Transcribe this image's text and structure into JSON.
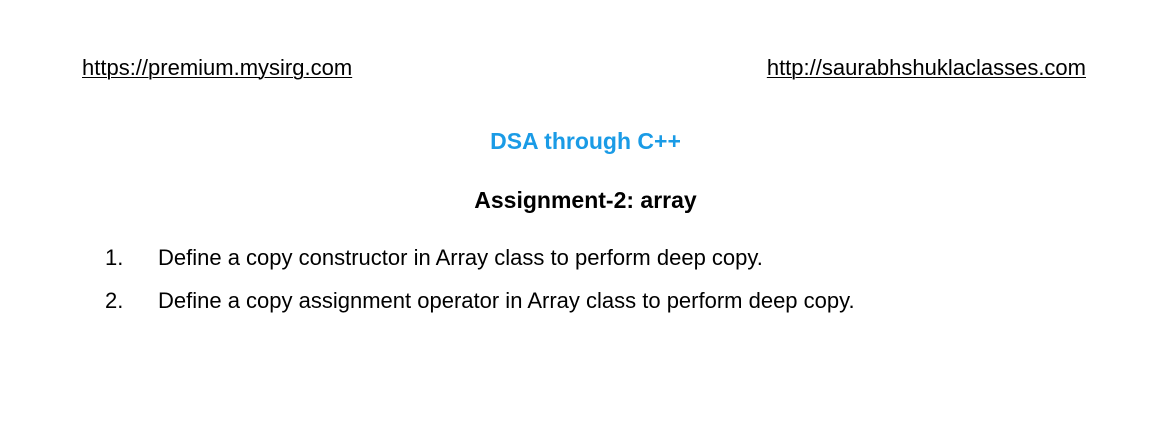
{
  "header": {
    "left_link": "https://premium.mysirg.com",
    "right_link": "http://saurabhshuklaclasses.com"
  },
  "document": {
    "course_title": "DSA through C++",
    "assignment_title": "Assignment-2: array",
    "tasks": [
      {
        "number": "1.",
        "text": "Define a copy constructor in Array class to perform deep copy."
      },
      {
        "number": "2.",
        "text": "Define a copy assignment operator in Array class to perform deep copy."
      }
    ]
  },
  "colors": {
    "course_title": "#1a9be6",
    "text": "#000000",
    "background": "#ffffff"
  }
}
